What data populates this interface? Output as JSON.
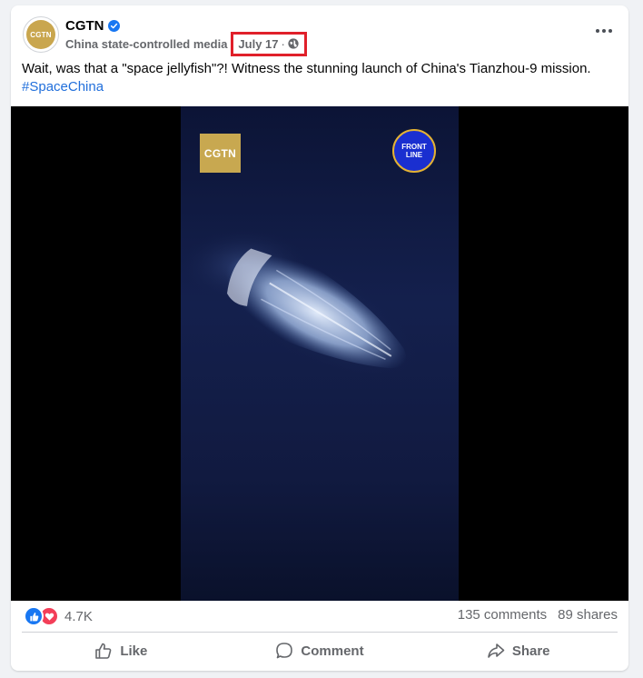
{
  "post": {
    "page_name": "CGTN",
    "avatar_text": "CGTN",
    "meta_label": "China state-controlled media",
    "date": "July 17",
    "date_separator": "·",
    "caption_text": "Wait, was that a \"space jellyfish\"?! Witness the stunning launch of China's Tianzhou-9 mission.",
    "hashtag": "#SpaceChina"
  },
  "media": {
    "left_logo": "CGTN",
    "right_logo_line1": "FRONT",
    "right_logo_line2": "LINE"
  },
  "stats": {
    "reaction_count": "4.7K",
    "comments": "135 comments",
    "shares": "89 shares"
  },
  "actions": {
    "like": "Like",
    "comment": "Comment",
    "share": "Share"
  },
  "colors": {
    "accent_blue": "#1877f2",
    "hashtag": "#216fdb",
    "highlight_box": "#e0202a",
    "love": "#f33e58"
  }
}
